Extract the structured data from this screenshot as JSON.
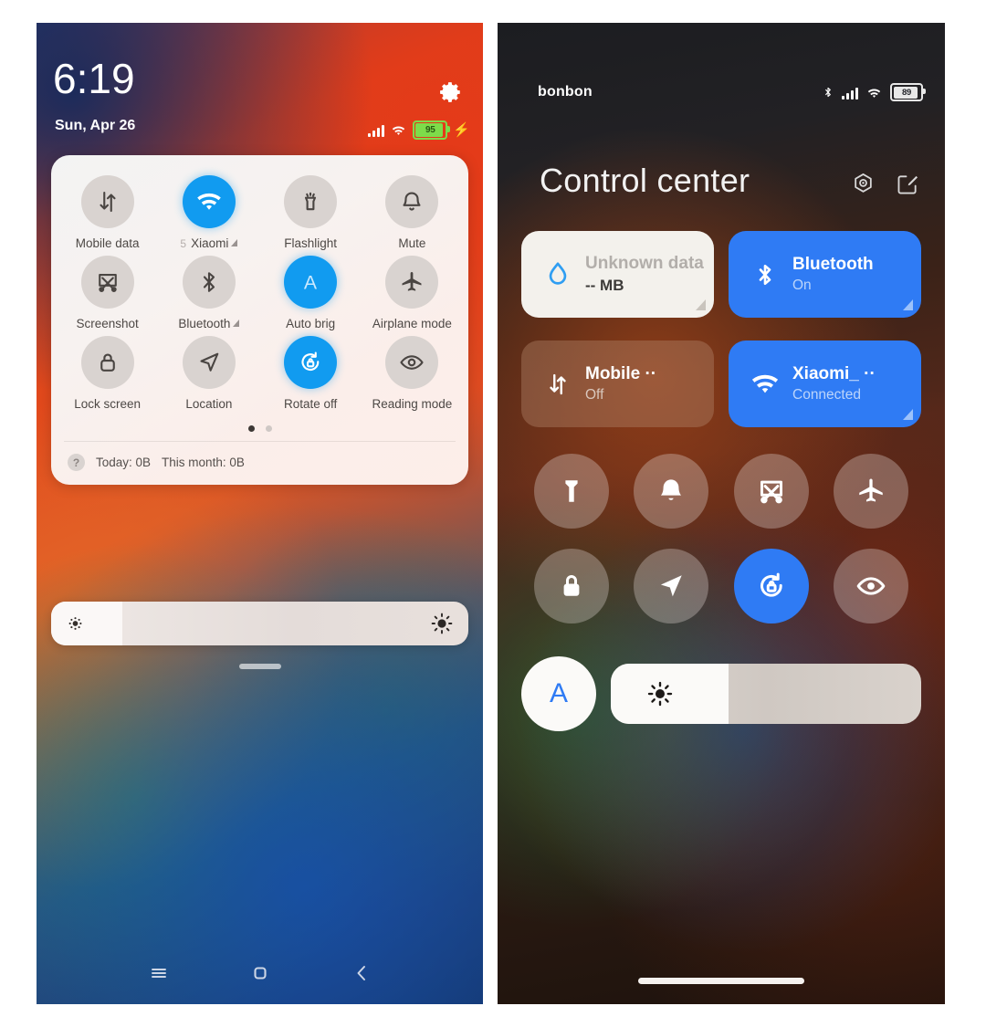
{
  "left_phone": {
    "status_bar": {
      "time": "6:19",
      "date": "Sun, Apr 26",
      "settings_icon": "gear-icon",
      "signal_icon": "signal-bars-icon",
      "wifi_icon": "wifi-icon",
      "battery_percent": "95",
      "charging_icon": "lightning-bolt-icon"
    },
    "quick_settings": {
      "tiles": [
        {
          "label": "Mobile data",
          "icon": "mobile-data-icon",
          "active": false,
          "prefix": "",
          "expand": false
        },
        {
          "label": "Xiaomi",
          "icon": "wifi-icon",
          "active": true,
          "prefix": "5",
          "expand": true
        },
        {
          "label": "Flashlight",
          "icon": "flashlight-icon",
          "active": false,
          "prefix": "",
          "expand": false
        },
        {
          "label": "Mute",
          "icon": "bell-icon",
          "active": false,
          "prefix": "",
          "expand": false
        },
        {
          "label": "Screenshot",
          "icon": "screenshot-icon",
          "active": false,
          "prefix": "",
          "expand": false
        },
        {
          "label": "Bluetooth",
          "icon": "bluetooth-icon",
          "active": false,
          "prefix": "",
          "expand": true
        },
        {
          "label": "Auto brig",
          "icon": "auto-brightness-a-icon",
          "active": true,
          "prefix": "",
          "expand": false
        },
        {
          "label": "Airplane mode",
          "icon": "airplane-icon",
          "active": false,
          "prefix": "",
          "expand": false
        },
        {
          "label": "Lock screen",
          "icon": "lock-icon",
          "active": false,
          "prefix": "",
          "expand": false
        },
        {
          "label": "Location",
          "icon": "location-arrow-icon",
          "active": false,
          "prefix": "",
          "expand": false
        },
        {
          "label": "Rotate off",
          "icon": "rotate-lock-icon",
          "active": true,
          "prefix": "",
          "expand": false
        },
        {
          "label": "Reading mode",
          "icon": "eye-icon",
          "active": false,
          "prefix": "",
          "expand": false
        }
      ],
      "page_dots": {
        "total": 2,
        "active_index": 0
      },
      "data_usage": {
        "help_icon": "question-mark-icon",
        "today_label": "Today: 0B",
        "month_label": "This month: 0B"
      }
    },
    "brightness": {
      "value_percent": 17,
      "low_icon": "brightness-low-icon",
      "high_icon": "brightness-high-icon"
    },
    "nav_bar": {
      "recents_icon": "recents-menu-icon",
      "home_icon": "home-square-icon",
      "back_icon": "back-chevron-icon"
    },
    "colors": {
      "accent_blue": "#119bf0",
      "tile_idle": "#d9d3d0",
      "battery_green": "#7ddc4a"
    }
  },
  "right_phone": {
    "status_bar": {
      "carrier": "bonbon",
      "bluetooth_icon": "bluetooth-icon",
      "signal_icon": "signal-bars-icon",
      "wifi_icon": "wifi-icon",
      "battery_percent": "89"
    },
    "header": {
      "title": "Control center",
      "settings_icon": "hex-settings-icon",
      "edit_icon": "edit-pencil-icon"
    },
    "big_tiles": [
      {
        "title": "Unknown data",
        "subtitle": "-- MB",
        "icon": "data-drop-icon",
        "style": "light",
        "expand": true
      },
      {
        "title": "Bluetooth",
        "subtitle": "On",
        "icon": "bluetooth-icon",
        "style": "blue",
        "expand": true
      },
      {
        "title": "Mobile ··",
        "subtitle": "Off",
        "icon": "mobile-data-icon",
        "style": "dim",
        "expand": false
      },
      {
        "title": "Xiaomi_ ··",
        "subtitle": "Connected",
        "icon": "wifi-icon",
        "style": "blue",
        "expand": true
      }
    ],
    "round_tiles": [
      {
        "name": "Flashlight",
        "icon": "flashlight-icon",
        "active": false
      },
      {
        "name": "Mute",
        "icon": "bell-icon",
        "active": false
      },
      {
        "name": "Screenshot",
        "icon": "screenshot-icon",
        "active": false
      },
      {
        "name": "Airplane mode",
        "icon": "airplane-icon",
        "active": false
      },
      {
        "name": "Lock screen",
        "icon": "lock-icon",
        "active": false
      },
      {
        "name": "Location",
        "icon": "location-arrow-icon",
        "active": false
      },
      {
        "name": "Rotate off",
        "icon": "rotate-lock-icon",
        "active": true
      },
      {
        "name": "Reading mode",
        "icon": "eye-icon",
        "active": false
      }
    ],
    "brightness": {
      "auto_label": "A",
      "auto_icon": "auto-brightness-a-icon",
      "value_percent": 38,
      "sun_icon": "brightness-high-icon"
    },
    "home_indicator": "home-indicator-bar",
    "colors": {
      "accent_blue": "#2f7bf4",
      "tile_idle": "rgba(228,220,216,0.33)",
      "panel_light": "#f3f1ec"
    }
  }
}
